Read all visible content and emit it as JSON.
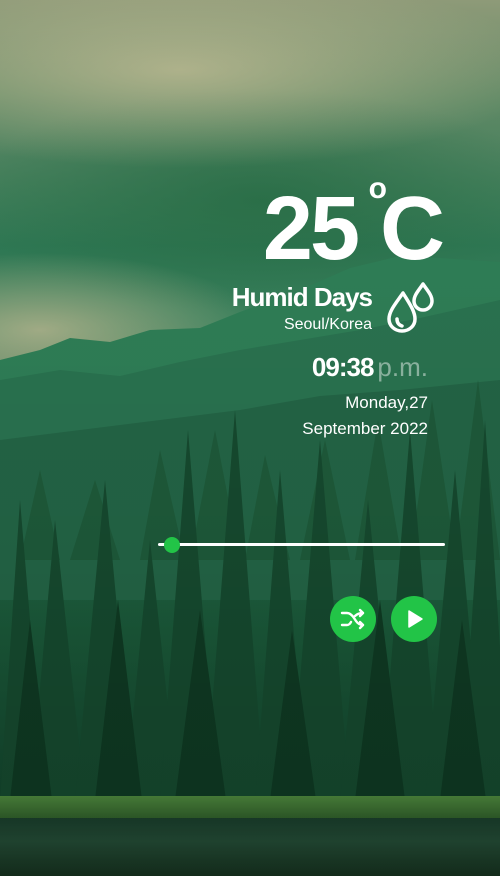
{
  "weather": {
    "temperature": "25",
    "degree_symbol": "o",
    "unit": "C",
    "condition": "Humid Days",
    "location": "Seoul/Korea",
    "condition_icon": "water-drops-icon"
  },
  "clock": {
    "time": "09:38",
    "period": "p.m.",
    "date_line1": "Monday,27",
    "date_line2": "September 2022"
  },
  "player": {
    "progress": 0.05,
    "controls": [
      "shuffle-icon",
      "play-icon"
    ]
  },
  "colors": {
    "accent": "#22c447",
    "text": "#ffffff",
    "track": "#ffffff"
  }
}
